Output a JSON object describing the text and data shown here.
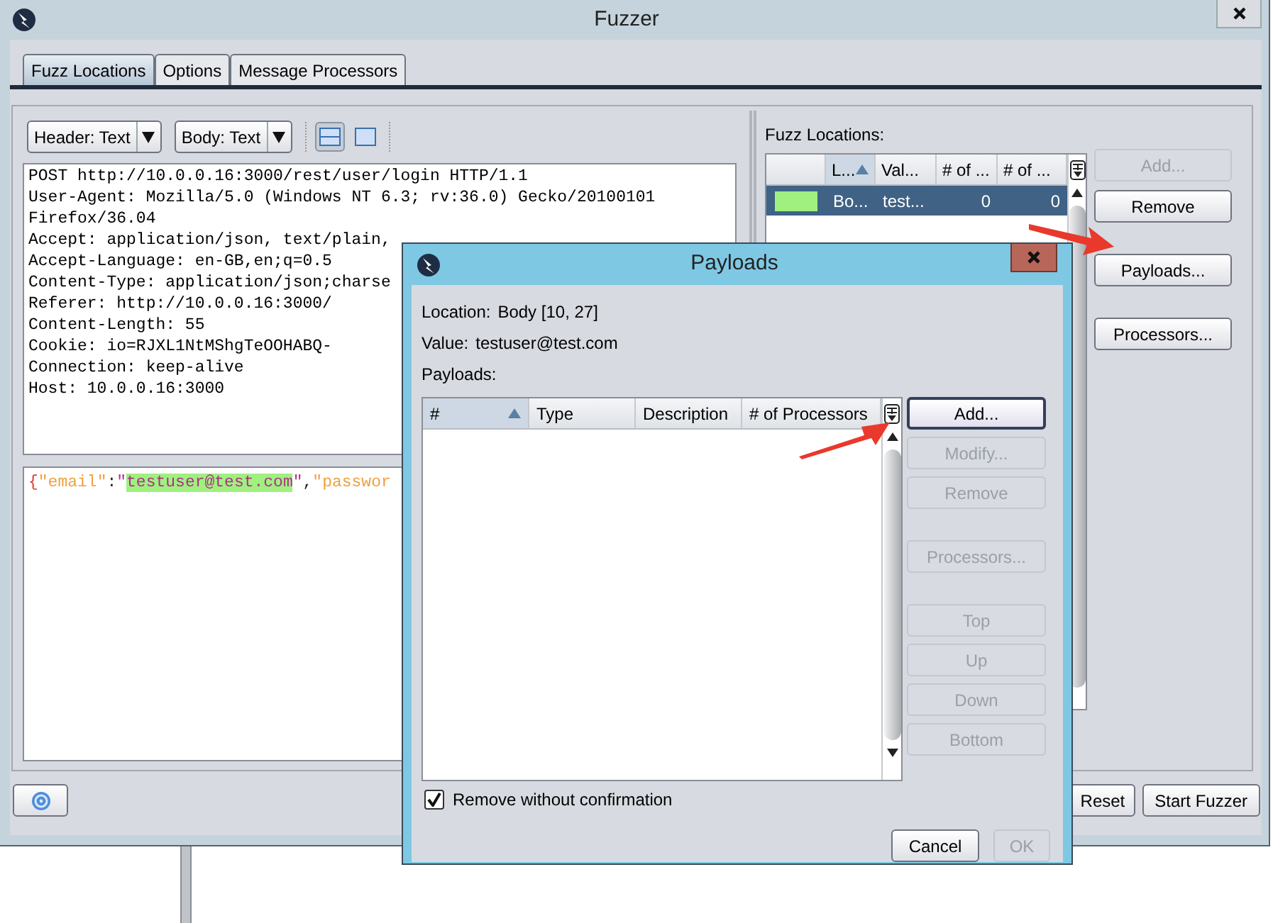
{
  "window": {
    "title": "Fuzzer"
  },
  "tabs": [
    {
      "label": "Fuzz Locations",
      "selected": true
    },
    {
      "label": "Options",
      "selected": false
    },
    {
      "label": "Message Processors",
      "selected": false
    }
  ],
  "toolbar": {
    "header_view": "Header: Text",
    "body_view": "Body: Text",
    "layouts": [
      {
        "selected": true
      },
      {
        "selected": false
      }
    ]
  },
  "request_header_lines": [
    "POST http://10.0.0.16:3000/rest/user/login HTTP/1.1",
    "User-Agent: Mozilla/5.0 (Windows NT 6.3; rv:36.0) Gecko/20100101",
    "Firefox/36.04",
    "Accept: application/json, text/plain,",
    "Accept-Language: en-GB,en;q=0.5",
    "Content-Type: application/json;charse",
    "Referer: http://10.0.0.16:3000/",
    "Content-Length: 55",
    "Cookie: io=RJXL1NtMShgTeOOHABQ-",
    "Connection: keep-alive",
    "Host: 10.0.0.16:3000"
  ],
  "request_body": [
    {
      "kind": "brace",
      "text": "{"
    },
    {
      "kind": "key",
      "text": "\"email\""
    },
    {
      "kind": "punct",
      "text": ":"
    },
    {
      "kind": "quote",
      "text": "\""
    },
    {
      "kind": "fuzz",
      "text": "testuser@test.com"
    },
    {
      "kind": "quote",
      "text": "\""
    },
    {
      "kind": "punct",
      "text": ","
    },
    {
      "kind": "key",
      "text": "\"passwor"
    }
  ],
  "fuzz_locations": {
    "label": "Fuzz Locations:",
    "columns": [
      {
        "label": "L...",
        "sorted": true
      },
      {
        "label": "Val...",
        "sorted": false
      },
      {
        "label": "# of ...",
        "sorted": false
      },
      {
        "label": "# of ...",
        "sorted": false
      }
    ],
    "rows": [
      {
        "color": "#a0f080",
        "selected": true,
        "cells": [
          "Bo...",
          "test...",
          "0",
          "0"
        ]
      }
    ],
    "buttons": [
      {
        "label": "Add...",
        "disabled": true
      },
      {
        "label": "Remove",
        "disabled": false
      },
      {
        "label": "Payloads...",
        "disabled": false
      },
      {
        "label": "Processors...",
        "disabled": false
      }
    ]
  },
  "bottom_buttons": [
    {
      "label": "Reset"
    },
    {
      "label": "Start Fuzzer"
    }
  ],
  "dialog": {
    "title": "Payloads",
    "location_label": "Location:",
    "location": "Body [10, 27]",
    "value_label": "Value:",
    "value": "testuser@test.com",
    "payloads_label": "Payloads:",
    "columns": [
      {
        "label": "#",
        "sorted": true
      },
      {
        "label": "Type",
        "sorted": false
      },
      {
        "label": "Description",
        "sorted": false
      },
      {
        "label": "# of Processors",
        "sorted": false
      }
    ],
    "button_groups": [
      [
        {
          "label": "Add...",
          "disabled": false,
          "focused": true
        },
        {
          "label": "Modify...",
          "disabled": true,
          "focused": false
        },
        {
          "label": "Remove",
          "disabled": true,
          "focused": false
        }
      ],
      [
        {
          "label": "Processors...",
          "disabled": true,
          "focused": false
        }
      ],
      [
        {
          "label": "Top",
          "disabled": true,
          "focused": false
        },
        {
          "label": "Up",
          "disabled": true,
          "focused": false
        },
        {
          "label": "Down",
          "disabled": true,
          "focused": false
        },
        {
          "label": "Bottom",
          "disabled": true,
          "focused": false
        }
      ]
    ],
    "remove_without_confirmation": {
      "label": "Remove without confirmation",
      "checked": true
    },
    "footer_buttons": [
      {
        "label": "Cancel",
        "disabled": false
      },
      {
        "label": "OK",
        "disabled": true
      }
    ]
  }
}
